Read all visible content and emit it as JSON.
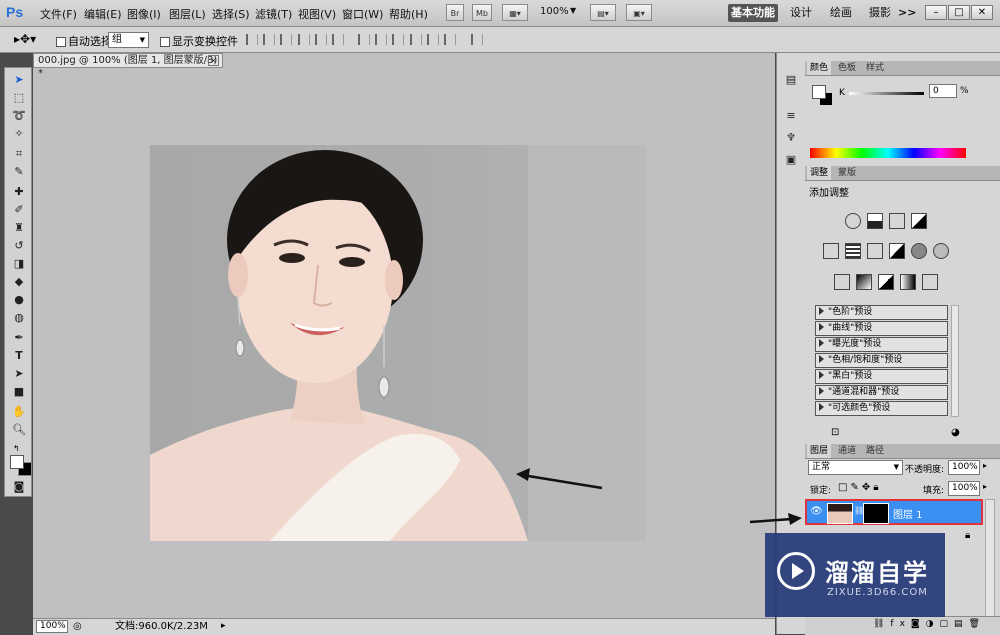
{
  "app": {
    "logo": "Ps"
  },
  "menu": [
    "文件(F)",
    "编辑(E)",
    "图像(I)",
    "图层(L)",
    "选择(S)",
    "滤镜(T)",
    "视图(V)",
    "窗口(W)",
    "帮助(H)"
  ],
  "toolbar": {
    "br": "Br",
    "mb": "Mb",
    "zoom": "100%",
    "workspace_active": "基本功能",
    "workspace_items": [
      "设计",
      "绘画",
      "摄影"
    ],
    "more": ">>"
  },
  "options": {
    "auto_select_label": "自动选择:",
    "auto_select_value": "组",
    "show_transform_label": "显示变换控件"
  },
  "document": {
    "tab_title": "000.jpg @ 100% (图层 1, 图层蒙版/8) *",
    "close": "×"
  },
  "status": {
    "zoom": "100%",
    "doc_info": "文档:960.0K/2.23M"
  },
  "color_panel": {
    "tabs": [
      "颜色",
      "色板",
      "样式"
    ],
    "channel": "K",
    "value": "0",
    "unit": "%"
  },
  "adjust_panel": {
    "tabs": [
      "调整",
      "蒙版"
    ],
    "heading": "添加调整",
    "presets": [
      "\"色阶\"预设",
      "\"曲线\"预设",
      "\"曝光度\"预设",
      "\"色相/饱和度\"预设",
      "\"黑白\"预设",
      "\"通道混和器\"预设",
      "\"可选颜色\"预设"
    ]
  },
  "layers_panel": {
    "tabs": [
      "图层",
      "通道",
      "路径"
    ],
    "blend_mode": "正常",
    "opacity_label": "不透明度:",
    "opacity": "100%",
    "lock_label": "锁定:",
    "fill_label": "填充:",
    "fill": "100%",
    "layer_name": "图层 1"
  },
  "watermark": {
    "title": "溜溜自学",
    "url": "ZIXUE.3D66.COM"
  },
  "colors": {
    "accent": "#3b8ff0",
    "highlight_border": "#e0343c",
    "watermark_bg": "#2b3e7a"
  }
}
